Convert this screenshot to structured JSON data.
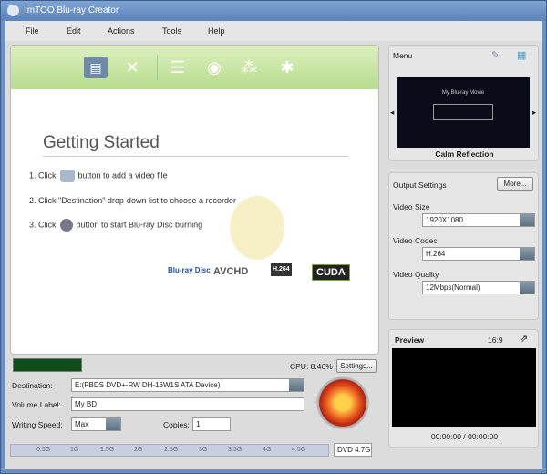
{
  "window": {
    "title": "ImTOO Blu-ray Creator"
  },
  "menu": [
    "File",
    "Edit",
    "Actions",
    "Tools",
    "Help"
  ],
  "getting_started": {
    "title": "Getting Started",
    "steps": [
      {
        "pre": "1. Click",
        "post": "button to add a video file"
      },
      {
        "text": "2. Click \"Destination\" drop-down list to choose a recorder"
      },
      {
        "pre": "3. Click",
        "post": "button to start Blu-ray Disc burning"
      }
    ],
    "logos": [
      "Blu-ray Disc",
      "AVCHD",
      "H.264",
      "CUDA"
    ]
  },
  "status": {
    "cpu": "CPU: 8.46%",
    "settings_label": "Settings..."
  },
  "form": {
    "destination_label": "Destination:",
    "destination_value": "E:(PBDS DVD+-RW DH-16W1S ATA Device)",
    "volume_label": "Volume Label:",
    "volume_value": "My BD",
    "speed_label": "Writing Speed:",
    "speed_value": "Max",
    "copies_label": "Copies:",
    "copies_value": "1"
  },
  "ruler": {
    "ticks": [
      "0.5G",
      "1G",
      "1.5G",
      "2G",
      "2.5G",
      "3G",
      "3.5G",
      "4G",
      "4.5G"
    ],
    "disc": "DVD 4.7G"
  },
  "menu_panel": {
    "title": "Menu",
    "thumb_title": "My Blu-ray Movie",
    "template": "Calm Reflection"
  },
  "output": {
    "title": "Output Settings",
    "more": "More...",
    "size_label": "Video Size",
    "size_value": "1920X1080",
    "codec_label": "Video Codec",
    "codec_value": "H.264",
    "quality_label": "Video Quality",
    "quality_value": "12Mbps(Normal)"
  },
  "preview": {
    "title": "Preview",
    "ratio": "16:9",
    "time": "00:00:00 / 00:00:00"
  }
}
